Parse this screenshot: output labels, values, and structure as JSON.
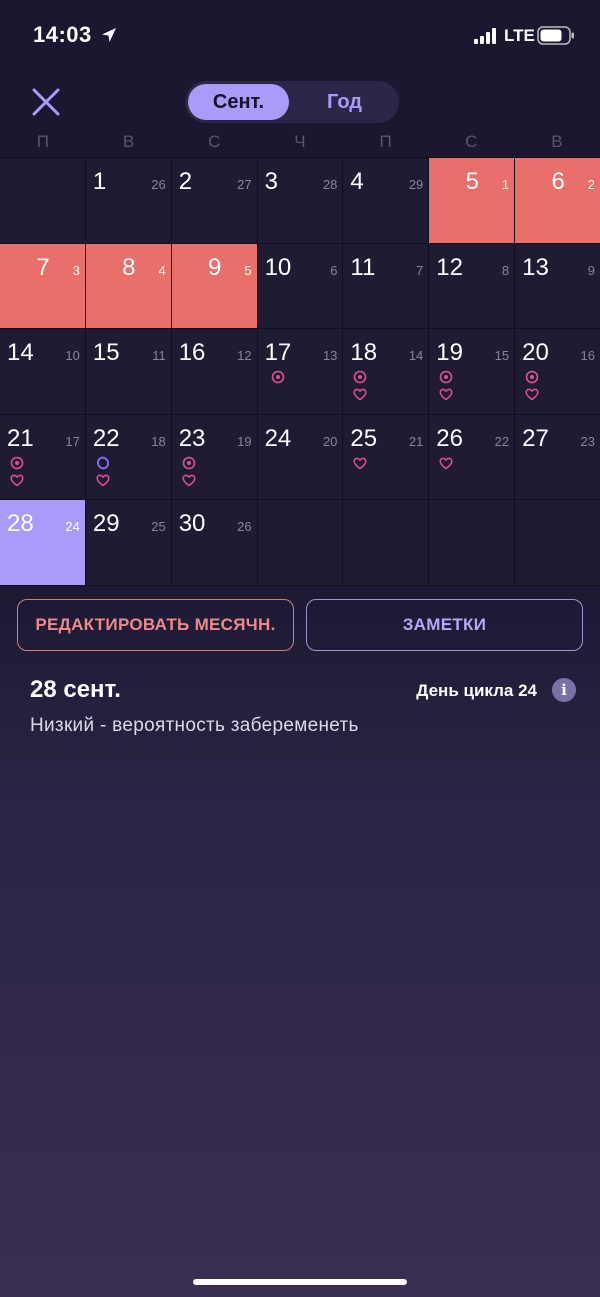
{
  "status_bar": {
    "time": "14:03",
    "network": "LTE"
  },
  "header": {
    "tabs": [
      {
        "label": "Сент.",
        "active": true
      },
      {
        "label": "Год",
        "active": false
      }
    ]
  },
  "weekdays": [
    "П",
    "В",
    "С",
    "Ч",
    "П",
    "С",
    "В"
  ],
  "calendar": {
    "rows": [
      [
        {
          "day": "",
          "cycle": ""
        },
        {
          "day": "1",
          "cycle": "26"
        },
        {
          "day": "2",
          "cycle": "27"
        },
        {
          "day": "3",
          "cycle": "28"
        },
        {
          "day": "4",
          "cycle": "29"
        },
        {
          "day": "5",
          "cycle": "1",
          "period": true
        },
        {
          "day": "6",
          "cycle": "2",
          "period": true
        }
      ],
      [
        {
          "day": "7",
          "cycle": "3",
          "period": true
        },
        {
          "day": "8",
          "cycle": "4",
          "period": true
        },
        {
          "day": "9",
          "cycle": "5",
          "period": true
        },
        {
          "day": "10",
          "cycle": "6"
        },
        {
          "day": "11",
          "cycle": "7"
        },
        {
          "day": "12",
          "cycle": "8"
        },
        {
          "day": "13",
          "cycle": "9"
        }
      ],
      [
        {
          "day": "14",
          "cycle": "10"
        },
        {
          "day": "15",
          "cycle": "11"
        },
        {
          "day": "16",
          "cycle": "12"
        },
        {
          "day": "17",
          "cycle": "13",
          "icons": [
            "ovulation-icon"
          ]
        },
        {
          "day": "18",
          "cycle": "14",
          "icons": [
            "ovulation-icon",
            "heart-icon"
          ]
        },
        {
          "day": "19",
          "cycle": "15",
          "icons": [
            "ovulation-icon",
            "heart-icon"
          ]
        },
        {
          "day": "20",
          "cycle": "16",
          "icons": [
            "ovulation-icon",
            "heart-icon"
          ]
        }
      ],
      [
        {
          "day": "21",
          "cycle": "17",
          "icons": [
            "ovulation-icon",
            "heart-icon"
          ]
        },
        {
          "day": "22",
          "cycle": "18",
          "icons": [
            "egg-icon",
            "heart-icon"
          ]
        },
        {
          "day": "23",
          "cycle": "19",
          "icons": [
            "ovulation-icon",
            "heart-icon"
          ]
        },
        {
          "day": "24",
          "cycle": "20"
        },
        {
          "day": "25",
          "cycle": "21",
          "icons": [
            "heart-icon"
          ]
        },
        {
          "day": "26",
          "cycle": "22",
          "icons": [
            "heart-icon"
          ]
        },
        {
          "day": "27",
          "cycle": "23"
        }
      ],
      [
        {
          "day": "28",
          "cycle": "24",
          "selected": true
        },
        {
          "day": "29",
          "cycle": "25"
        },
        {
          "day": "30",
          "cycle": "26"
        },
        {
          "day": "",
          "cycle": ""
        },
        {
          "day": "",
          "cycle": ""
        },
        {
          "day": "",
          "cycle": ""
        },
        {
          "day": "",
          "cycle": ""
        }
      ]
    ]
  },
  "actions": {
    "edit_label": "РЕДАКТИРОВАТЬ МЕСЯЧН.",
    "notes_label": "ЗАМЕТКИ"
  },
  "selection": {
    "date": "28 сент.",
    "cycle_day": "День цикла 24",
    "probability": "Низкий - вероятность забеременеть"
  },
  "colors": {
    "accent": "#a99cf8",
    "period": "#e86f6a",
    "cell": "#1e1b33",
    "icon_pink": "#e2508f",
    "icon_purple": "#8d6ff2"
  }
}
